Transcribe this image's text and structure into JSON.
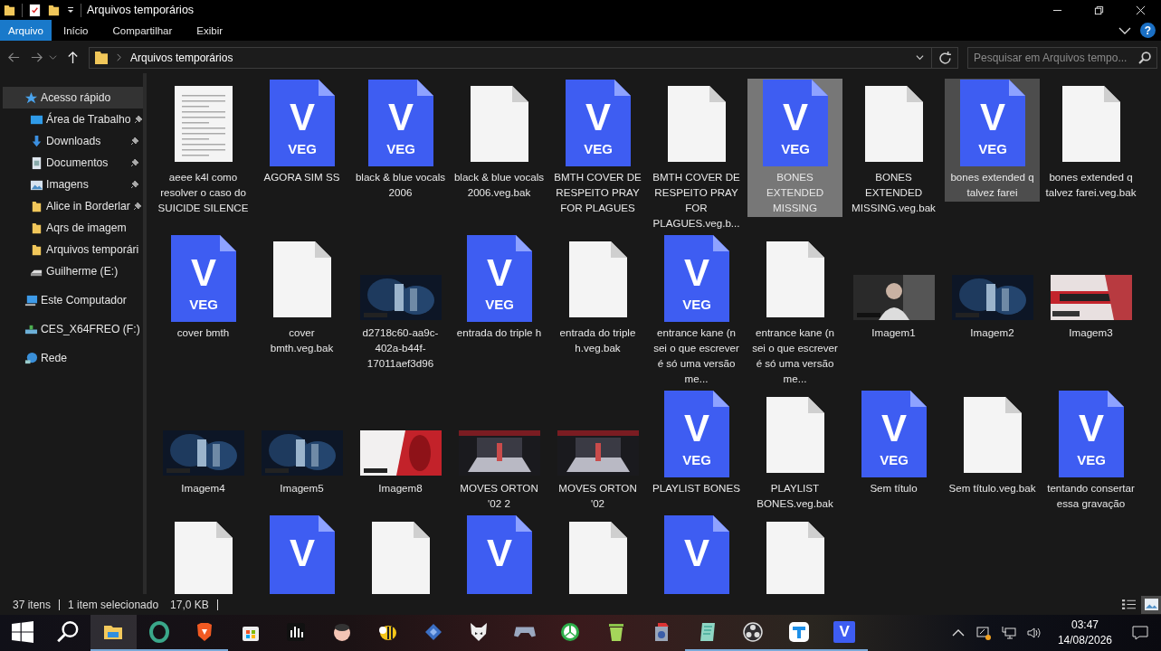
{
  "window": {
    "title": "Arquivos temporários"
  },
  "ribbon": {
    "tabs": [
      {
        "label": "Arquivo",
        "selected": true
      },
      {
        "label": "Início",
        "selected": false
      },
      {
        "label": "Compartilhar",
        "selected": false
      },
      {
        "label": "Exibir",
        "selected": false
      }
    ],
    "help": "?"
  },
  "address": {
    "path": "Arquivos temporários",
    "search_placeholder": "Pesquisar em Arquivos tempo..."
  },
  "sidebar": {
    "items": [
      {
        "label": "Acesso rápido",
        "selected": true,
        "children": [
          {
            "label": "Área de Trabalho",
            "pinned": true
          },
          {
            "label": "Downloads",
            "pinned": true
          },
          {
            "label": "Documentos",
            "pinned": true
          },
          {
            "label": "Imagens",
            "pinned": true
          },
          {
            "label": "Alice in Borderlar",
            "pinned": true
          },
          {
            "label": "Aqrs de imagem",
            "pinned": false
          },
          {
            "label": "Arquivos temporári",
            "pinned": false
          },
          {
            "label": "Guilherme (E:)",
            "pinned": false
          }
        ]
      },
      {
        "label": "Este Computador",
        "selected": false
      },
      {
        "label": "CES_X64FREO (F:)",
        "selected": false
      },
      {
        "label": "Rede",
        "selected": false
      }
    ]
  },
  "files": [
    {
      "kind": "text",
      "name": "aeee k4l como resolver o caso do SUICIDE SILENCE",
      "selected": false,
      "hovered": false
    },
    {
      "kind": "veg",
      "letter": "V",
      "badge": "VEG",
      "name": "AGORA SIM SS",
      "selected": false,
      "hovered": false
    },
    {
      "kind": "veg",
      "letter": "V",
      "badge": "VEG",
      "name": "black & blue vocals 2006",
      "selected": false,
      "hovered": false
    },
    {
      "kind": "blank",
      "name": "black & blue vocals 2006.veg.bak",
      "selected": false,
      "hovered": false
    },
    {
      "kind": "veg",
      "letter": "V",
      "badge": "VEG",
      "name": "BMTH COVER DE RESPEITO PRAY FOR PLAGUES",
      "selected": false,
      "hovered": false
    },
    {
      "kind": "blank",
      "name": "BMTH COVER DE RESPEITO PRAY FOR PLAGUES.veg.b...",
      "selected": false,
      "hovered": false
    },
    {
      "kind": "veg",
      "letter": "V",
      "badge": "VEG",
      "name": "BONES EXTENDED MISSING",
      "selected": true,
      "hovered": false
    },
    {
      "kind": "blank",
      "name": "BONES EXTENDED MISSING.veg.bak",
      "selected": false,
      "hovered": false
    },
    {
      "kind": "veg",
      "letter": "V",
      "badge": "VEG",
      "name": "bones extended q talvez farei",
      "selected": false,
      "hovered": true
    },
    {
      "kind": "blank",
      "name": "bones extended q talvez farei.veg.bak",
      "selected": false,
      "hovered": false
    },
    {
      "kind": "veg",
      "letter": "V",
      "badge": "VEG",
      "name": "cover bmth",
      "selected": false,
      "hovered": false
    },
    {
      "kind": "blank",
      "name": "cover bmth.veg.bak",
      "selected": false,
      "hovered": false
    },
    {
      "kind": "picture",
      "name": "d2718c60-aa9c-402a-b44f-17011aef3d96",
      "selected": false,
      "hovered": false
    },
    {
      "kind": "veg",
      "letter": "V",
      "badge": "VEG",
      "name": "entrada do triple h",
      "selected": false,
      "hovered": false
    },
    {
      "kind": "blank",
      "name": "entrada do triple h.veg.bak",
      "selected": false,
      "hovered": false
    },
    {
      "kind": "veg",
      "letter": "V",
      "badge": "VEG",
      "name": "entrance kane (n sei o que escrever é só uma versão me...",
      "selected": false,
      "hovered": false
    },
    {
      "kind": "blank",
      "name": "entrance kane (n sei o que escrever é só uma versão me...",
      "selected": false,
      "hovered": false
    },
    {
      "kind": "picture",
      "name": "Imagem1",
      "selected": false,
      "hovered": false
    },
    {
      "kind": "picture",
      "name": "Imagem2",
      "selected": false,
      "hovered": false
    },
    {
      "kind": "picture",
      "name": "Imagem3",
      "selected": false,
      "hovered": false
    },
    {
      "kind": "picture",
      "name": "Imagem4",
      "selected": false,
      "hovered": false
    },
    {
      "kind": "picture",
      "name": "Imagem5",
      "selected": false,
      "hovered": false
    },
    {
      "kind": "picture",
      "name": "Imagem8",
      "selected": false,
      "hovered": false
    },
    {
      "kind": "picture",
      "name": "MOVES ORTON '02 2",
      "selected": false,
      "hovered": false
    },
    {
      "kind": "picture",
      "name": "MOVES ORTON '02",
      "selected": false,
      "hovered": false
    },
    {
      "kind": "veg",
      "letter": "V",
      "badge": "VEG",
      "name": "PLAYLIST BONES",
      "selected": false,
      "hovered": false
    },
    {
      "kind": "blank",
      "name": "PLAYLIST BONES.veg.bak",
      "selected": false,
      "hovered": false
    },
    {
      "kind": "veg",
      "letter": "V",
      "badge": "VEG",
      "name": "Sem título",
      "selected": false,
      "hovered": false
    },
    {
      "kind": "blank",
      "name": "Sem título.veg.bak",
      "selected": false,
      "hovered": false
    },
    {
      "kind": "veg",
      "letter": "V",
      "badge": "VEG",
      "name": "tentando consertar essa gravação",
      "selected": false,
      "hovered": false
    },
    {
      "kind": "blank",
      "selected": false,
      "hovered": false
    },
    {
      "kind": "veg",
      "letter": "V",
      "selected": false,
      "hovered": false
    },
    {
      "kind": "blank",
      "selected": false,
      "hovered": false
    },
    {
      "kind": "veg",
      "letter": "V",
      "selected": false,
      "hovered": false
    },
    {
      "kind": "blank",
      "selected": false,
      "hovered": false
    },
    {
      "kind": "veg",
      "letter": "V",
      "selected": false,
      "hovered": false
    },
    {
      "kind": "blank",
      "selected": false,
      "hovered": false
    }
  ],
  "status_bar": {
    "count": "37 itens",
    "selection": "1 item selecionado",
    "size": "17,0 KB",
    "views": [
      {
        "kind": "details",
        "selected": false
      },
      {
        "kind": "large",
        "selected": true
      }
    ]
  },
  "taskbar": {
    "apps": [
      {
        "kind": "explorer",
        "running": true,
        "selected": true
      },
      {
        "kind": "ring",
        "running": true,
        "selected": false
      },
      {
        "kind": "lion",
        "running": true,
        "selected": false
      },
      {
        "kind": "store",
        "running": false,
        "selected": false
      },
      {
        "kind": "bars",
        "running": false,
        "selected": false
      },
      {
        "kind": "pig",
        "running": false,
        "selected": false
      },
      {
        "kind": "bee",
        "running": false,
        "selected": false
      },
      {
        "kind": "blocks",
        "running": false,
        "selected": false
      },
      {
        "kind": "fox",
        "running": false,
        "selected": false
      },
      {
        "kind": "gamepad",
        "running": false,
        "selected": false
      },
      {
        "kind": "triad",
        "running": false,
        "selected": false
      },
      {
        "kind": "bin",
        "running": false,
        "selected": false
      },
      {
        "kind": "r",
        "running": false,
        "selected": false
      },
      {
        "kind": "notepad",
        "running": true,
        "selected": false
      },
      {
        "kind": "obs",
        "running": true,
        "selected": false
      },
      {
        "kind": "tbox",
        "running": true,
        "selected": false
      },
      {
        "kind": "vegas",
        "letter": "V",
        "running": true,
        "selected": false
      }
    ],
    "time": "03:47",
    "date": "14/08/2026"
  }
}
